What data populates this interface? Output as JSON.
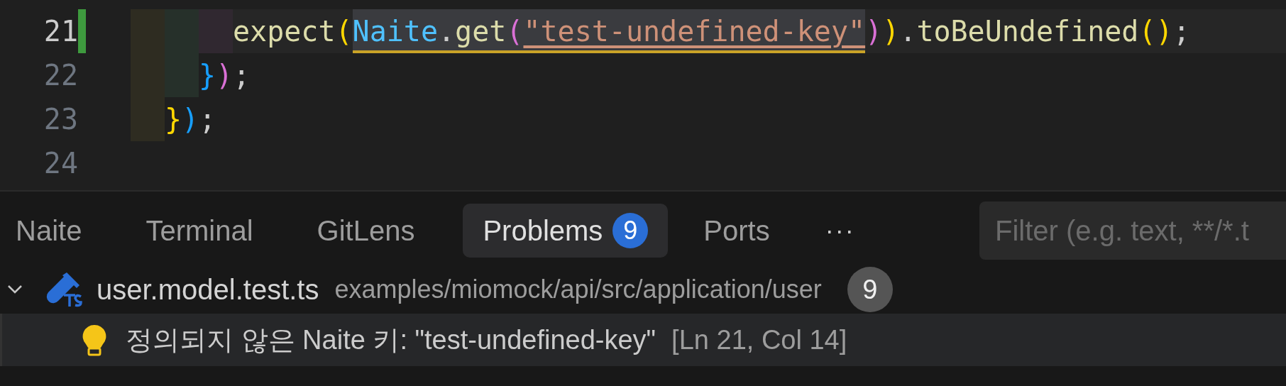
{
  "editor": {
    "lines": [
      {
        "number": "21",
        "current": true,
        "modified": true,
        "guides": [
          {
            "color": "#2e2c21"
          },
          {
            "color": "#26302a"
          },
          {
            "color": "#302830"
          }
        ],
        "tokens": [
          {
            "kind": "function",
            "text": "expect",
            "warning": false,
            "link": false
          },
          {
            "kind": "bracket-gold",
            "text": "(",
            "warning": false,
            "link": false
          },
          {
            "kind": "variable",
            "text": "Naite",
            "warning": true,
            "link": false
          },
          {
            "kind": "punctuation",
            "text": ".",
            "warning": true,
            "link": false
          },
          {
            "kind": "function",
            "text": "get",
            "warning": true,
            "link": false
          },
          {
            "kind": "bracket-orchid",
            "text": "(",
            "warning": true,
            "link": false
          },
          {
            "kind": "string",
            "text": "\"test-undefined-key\"",
            "warning": true,
            "link": true
          },
          {
            "kind": "bracket-orchid",
            "text": ")",
            "warning": false,
            "link": false
          },
          {
            "kind": "bracket-gold",
            "text": ")",
            "warning": false,
            "link": false
          },
          {
            "kind": "punctuation",
            "text": ".",
            "warning": false,
            "link": false
          },
          {
            "kind": "function",
            "text": "toBeUndefined",
            "warning": false,
            "link": false
          },
          {
            "kind": "bracket-gold",
            "text": "()",
            "warning": false,
            "link": false
          },
          {
            "kind": "punctuation",
            "text": ";",
            "warning": false,
            "link": false
          }
        ]
      },
      {
        "number": "22",
        "current": false,
        "modified": false,
        "guides": [
          {
            "color": "#2e2c21"
          },
          {
            "color": "#26302a"
          }
        ],
        "tokens": [
          {
            "kind": "bracket-blue",
            "text": "}",
            "warning": false,
            "link": false
          },
          {
            "kind": "bracket-orchid",
            "text": ")",
            "warning": false,
            "link": false
          },
          {
            "kind": "punctuation",
            "text": ";",
            "warning": false,
            "link": false
          }
        ]
      },
      {
        "number": "23",
        "current": false,
        "modified": false,
        "guides": [
          {
            "color": "#2e2c21"
          }
        ],
        "tokens": [
          {
            "kind": "bracket-gold",
            "text": "}",
            "warning": false,
            "link": false
          },
          {
            "kind": "bracket-blue",
            "text": ")",
            "warning": false,
            "link": false
          },
          {
            "kind": "punctuation",
            "text": ";",
            "warning": false,
            "link": false
          }
        ]
      },
      {
        "number": "24",
        "current": false,
        "modified": false
      }
    ]
  },
  "panel": {
    "tabs": [
      {
        "label": "Naite",
        "selected": false
      },
      {
        "label": "Terminal",
        "selected": false
      },
      {
        "label": "GitLens",
        "selected": false
      },
      {
        "label": "Problems",
        "selected": true,
        "badge": "9"
      },
      {
        "label": "Ports",
        "selected": false
      }
    ],
    "more": "···",
    "filter": {
      "placeholder": "Filter (e.g. text, **/*.t"
    }
  },
  "problems": {
    "files": [
      {
        "name": "user.model.test.ts",
        "path": "examples/miomock/api/src/application/user",
        "count": "9",
        "expanded": true,
        "children": [
          {
            "kind": "hint",
            "message": "정의되지 않은 Naite 키: \"test-undefined-key\"",
            "location": "[Ln 21, Col 14]",
            "selected": true
          }
        ]
      }
    ]
  }
}
